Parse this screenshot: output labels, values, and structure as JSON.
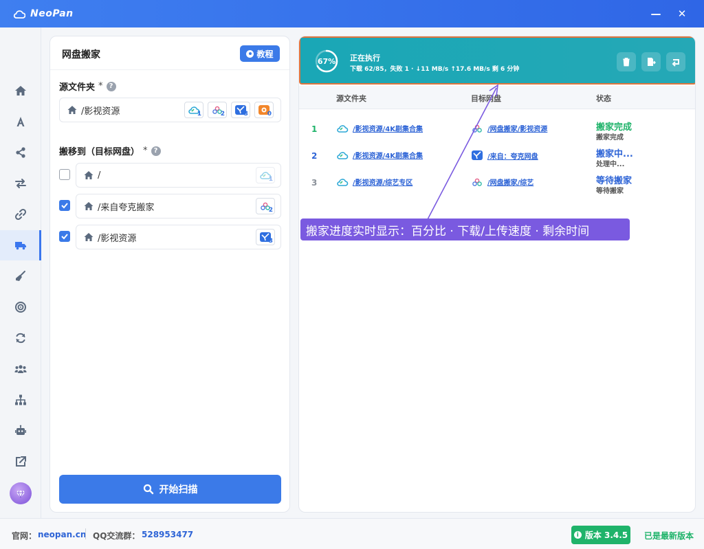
{
  "app": {
    "name": "NeoPan"
  },
  "window": {
    "minimize_glyph": "—",
    "close_glyph": "✕"
  },
  "sidebar": {
    "items": [
      {
        "icon": "home-icon"
      },
      {
        "icon": "font-icon"
      },
      {
        "icon": "share-icon"
      },
      {
        "icon": "transfer-icon"
      },
      {
        "icon": "link-icon"
      },
      {
        "icon": "truck-icon",
        "active": true
      },
      {
        "icon": "broom-icon"
      },
      {
        "icon": "target-icon"
      },
      {
        "icon": "sync-icon"
      },
      {
        "icon": "users-icon"
      },
      {
        "icon": "sitemap-icon"
      },
      {
        "icon": "robot-icon"
      },
      {
        "icon": "external-link-icon"
      }
    ]
  },
  "left_panel": {
    "title": "网盘搬家",
    "tutorial_label": "教程",
    "source_label": "源文件夹",
    "source_required": "*",
    "help": "?",
    "source_path": "/影视资源",
    "source_drives": [
      {
        "icon": "baidu-cloud-icon",
        "sub": "1"
      },
      {
        "icon": "aliyun-drive-icon",
        "sub": "2"
      },
      {
        "icon": "quark-drive-icon",
        "sub": "3"
      },
      {
        "icon": "xunlei-drive-icon",
        "sub": "0"
      }
    ],
    "target_label": "搬移到（目标网盘）",
    "target_required": "*",
    "targets": [
      {
        "path": "/",
        "checked": false,
        "drive_icon": "baidu-cloud-icon",
        "sub": "1"
      },
      {
        "path": "/来自夸克搬家",
        "checked": true,
        "drive_icon": "aliyun-drive-icon",
        "sub": "2"
      },
      {
        "path": "/影视资源",
        "checked": true,
        "drive_icon": "quark-drive-icon",
        "sub": "3"
      }
    ],
    "scan_button": "开始扫描"
  },
  "banner": {
    "percent": 67,
    "percent_label": "67%",
    "title": "正在执行",
    "detail": "下载 62/85，失败 1 · ↓11 MB/s ↑17.6 MB/s 剩 6 分钟",
    "buttons": [
      "trash-icon",
      "export-icon",
      "reply-icon"
    ]
  },
  "table": {
    "headers": {
      "source": "源文件夹",
      "target": "目标网盘",
      "status": "状态"
    },
    "rows": [
      {
        "index": "1",
        "source": "/影视资源/4K剧集合集",
        "target": "/网盘搬家/影视资源",
        "target_icon": "aliyun-drive-icon",
        "status": "搬家完成",
        "status_sub": "搬家完成",
        "status_color": "#1fb36a",
        "index_color": "#1fb36a"
      },
      {
        "index": "2",
        "source": "/影视资源/4K剧集合集",
        "target": "/来自：夸克网盘",
        "target_icon": "quark-drive-icon",
        "status": "搬家中...",
        "status_sub": "处理中...",
        "status_color": "#2e64d6",
        "index_color": "#2e64d6"
      },
      {
        "index": "3",
        "source": "/影视资源/综艺专区",
        "target": "/网盘搬家/综艺",
        "target_icon": "aliyun-drive-icon",
        "status": "等待搬家",
        "status_sub": "等待搬家",
        "status_color": "#2e64d6",
        "index_color": "#8a9099"
      }
    ]
  },
  "annotation": {
    "text": "搬家进度实时显示：百分比 · 下载/上传速度 · 剩余时间"
  },
  "footer": {
    "site_label": "官网：",
    "site_value": "neopan.cn",
    "qq_label": "QQ交流群：",
    "qq_value": "528953477",
    "version": "版本 3.4.5",
    "version_icon": "i",
    "latest": "已是最新版本"
  },
  "colors": {
    "primary": "#3b7ae8",
    "banner": "#1aa7b6",
    "success": "#1fb36a",
    "annotation": "#7a5ae0"
  }
}
